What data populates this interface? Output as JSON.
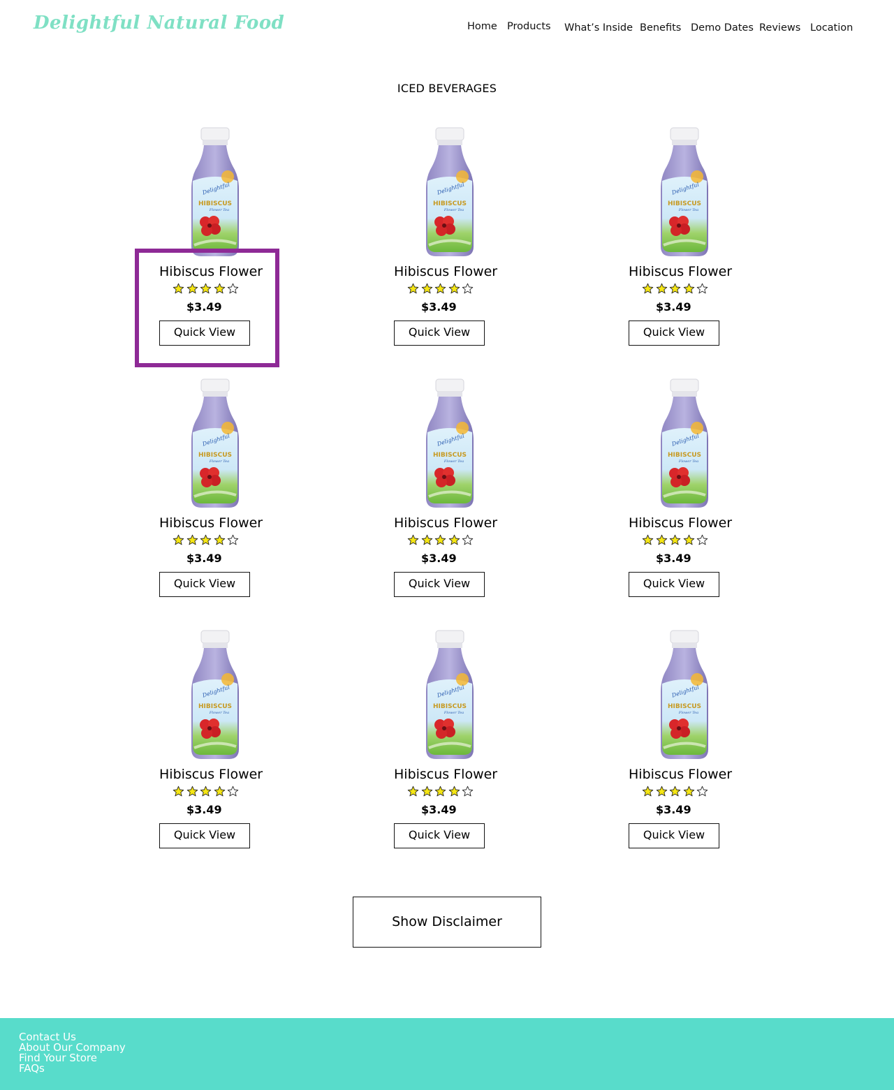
{
  "header": {
    "logo": "Delightful Natural Food",
    "nav": [
      "Home",
      "Products",
      "What’s Inside",
      "Benefits",
      "Demo Dates",
      "Reviews",
      "Location"
    ]
  },
  "section_title": "ICED BEVERAGES",
  "products": [
    {
      "name": "Hibiscus Flower",
      "rating": 4,
      "rating_max": 5,
      "price": "$3.49",
      "button": "Quick View"
    },
    {
      "name": "Hibiscus Flower",
      "rating": 4,
      "rating_max": 5,
      "price": "$3.49",
      "button": "Quick View"
    },
    {
      "name": "Hibiscus Flower",
      "rating": 4,
      "rating_max": 5,
      "price": "$3.49",
      "button": "Quick View"
    },
    {
      "name": "Hibiscus Flower",
      "rating": 4,
      "rating_max": 5,
      "price": "$3.49",
      "button": "Quick View"
    },
    {
      "name": "Hibiscus Flower",
      "rating": 4,
      "rating_max": 5,
      "price": "$3.49",
      "button": "Quick View"
    },
    {
      "name": "Hibiscus Flower",
      "rating": 4,
      "rating_max": 5,
      "price": "$3.49",
      "button": "Quick View"
    },
    {
      "name": "Hibiscus Flower",
      "rating": 4,
      "rating_max": 5,
      "price": "$3.49",
      "button": "Quick View"
    },
    {
      "name": "Hibiscus Flower",
      "rating": 4,
      "rating_max": 5,
      "price": "$3.49",
      "button": "Quick View"
    },
    {
      "name": "Hibiscus Flower",
      "rating": 4,
      "rating_max": 5,
      "price": "$3.49",
      "button": "Quick View"
    }
  ],
  "disclaimer_button": "Show Disclaimer",
  "footer": {
    "links": [
      "Contact Us",
      "About Our Company",
      "Find Your Store",
      "FAQs"
    ]
  },
  "colors": {
    "logo": "#7fe0c4",
    "footer_bg": "#58dccb",
    "highlight": "#8e2a96",
    "star_fill": "#f5e614"
  },
  "icons": {
    "star_filled": "star-filled-icon",
    "star_empty": "star-empty-icon"
  }
}
